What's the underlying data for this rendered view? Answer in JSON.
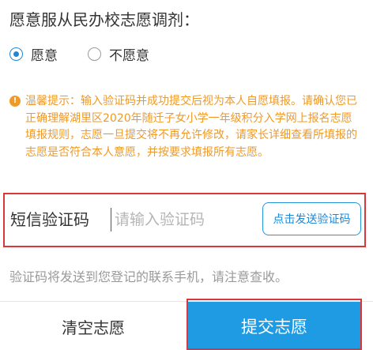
{
  "question": {
    "text": "愿意服从民办校志愿调剂："
  },
  "radio": {
    "options": [
      {
        "label": "愿意",
        "checked": true
      },
      {
        "label": "不愿意",
        "checked": false
      }
    ]
  },
  "notice": {
    "icon": "info-icon",
    "text": "温馨提示：输入验证码并成功提交后视为本人自愿填报。请确认您已正确理解湖里区2020年随迁子女小学一年级积分入学网上报名志愿填报规则，志愿一旦提交将不再允许修改，请家长详细查看所填报的志愿是否符合本人意愿，并按要求填报所有志愿。"
  },
  "sms": {
    "label": "短信验证码",
    "value": "",
    "placeholder": "请输入验证码",
    "send_label": "点击发送验证码",
    "hint": "验证码将发送到您登记的联系手机，请注意查收。"
  },
  "actions": {
    "clear_label": "清空志愿",
    "submit_label": "提交志愿"
  },
  "colors": {
    "accent": "#1e9be2",
    "warning": "#ef9a28",
    "highlight": "#d9383a"
  }
}
